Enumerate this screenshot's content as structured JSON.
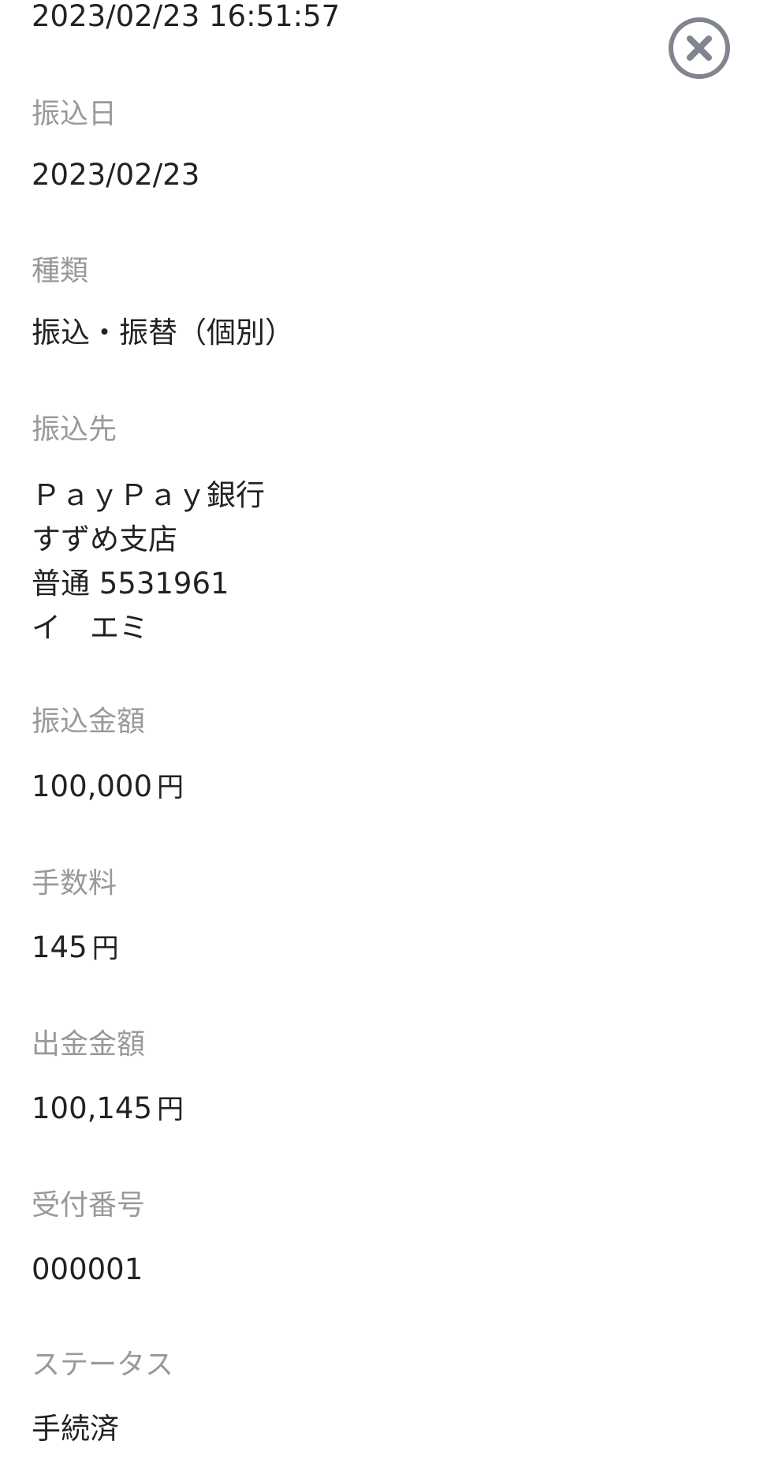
{
  "header": {
    "datetime": "2023/02/23 16:51:57",
    "close_icon": "close-circle-icon",
    "icon_color": "#808590"
  },
  "fields": {
    "transfer_date": {
      "label": "振込日",
      "value": "2023/02/23"
    },
    "type": {
      "label": "種類",
      "value": "振込・振替（個別）"
    },
    "destination": {
      "label": "振込先",
      "lines": [
        "ＰａｙＰａｙ銀行",
        "すずめ支店",
        "普通 5531961",
        "イ　エミ"
      ]
    },
    "transfer_amount": {
      "label": "振込金額",
      "amount": "100,000",
      "unit": "円"
    },
    "fee": {
      "label": "手数料",
      "amount": "145",
      "unit": "円"
    },
    "withdrawal_amount": {
      "label": "出金金額",
      "amount": "100,145",
      "unit": "円"
    },
    "receipt_number": {
      "label": "受付番号",
      "value": "000001"
    },
    "status": {
      "label": "ステータス",
      "value": "手続済"
    }
  },
  "colors": {
    "label": "#999999",
    "value": "#222222",
    "background": "#ffffff"
  }
}
